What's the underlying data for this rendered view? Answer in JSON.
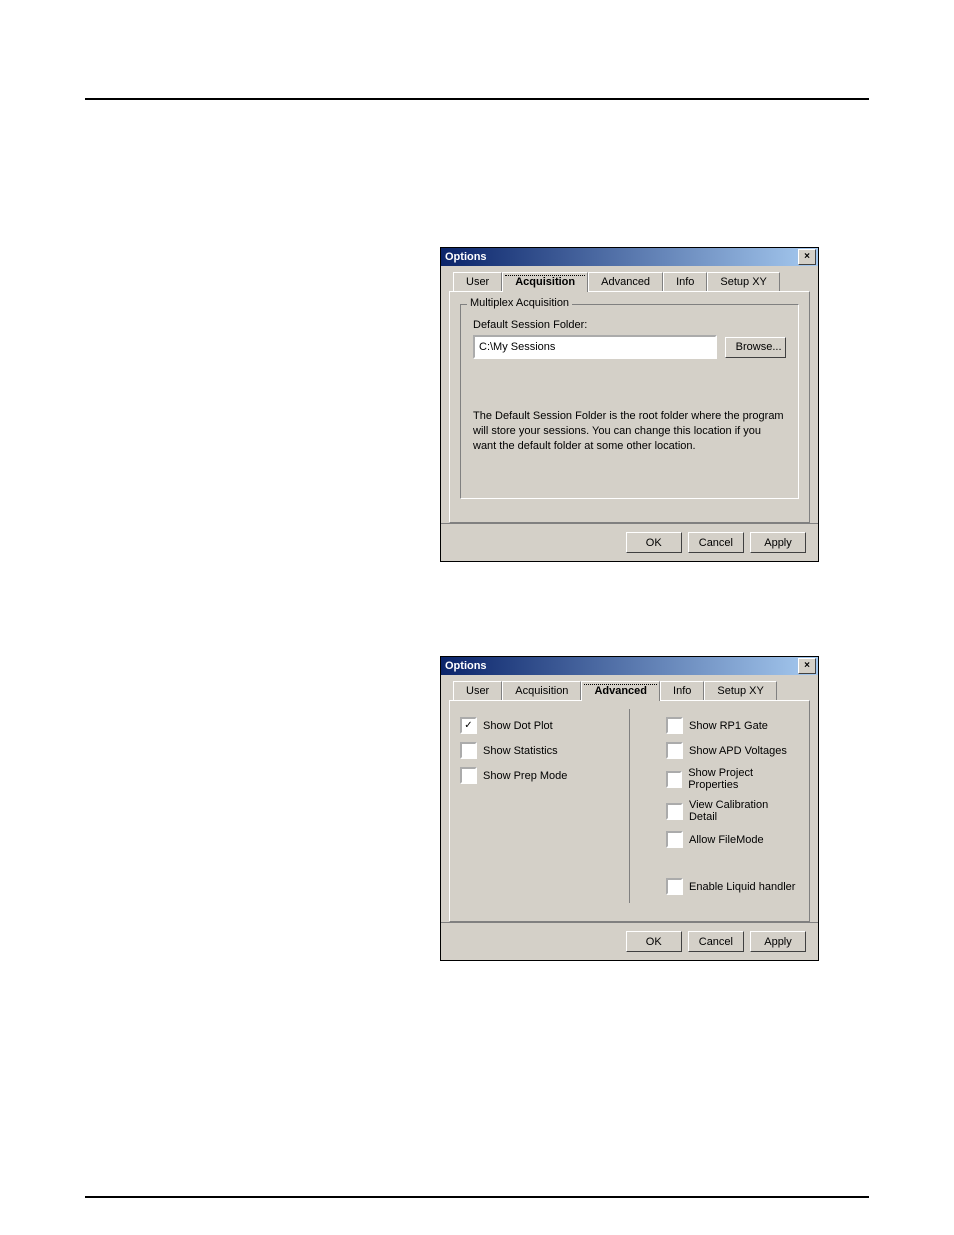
{
  "rules": {
    "top1": 98,
    "top2": 1196
  },
  "dialog1": {
    "title": "Options",
    "tabs": [
      "User",
      "Acquisition",
      "Advanced",
      "Info",
      "Setup XY"
    ],
    "activeTab": "Acquisition",
    "group": {
      "title": "Multiplex Acquisition",
      "label": "Default Session Folder:",
      "path": "C:\\My Sessions",
      "browse": "Browse..."
    },
    "help": "The Default Session Folder is the root folder where the program will store your sessions. You can change this location if you want the default folder at some other location.",
    "buttons": {
      "ok": "OK",
      "cancel": "Cancel",
      "apply": "Apply"
    }
  },
  "dialog2": {
    "title": "Options",
    "tabs": [
      "User",
      "Acquisition",
      "Advanced",
      "Info",
      "Setup XY"
    ],
    "activeTab": "Advanced",
    "left": [
      {
        "label": "Show Dot Plot",
        "checked": true
      },
      {
        "label": "Show Statistics",
        "checked": false
      },
      {
        "label": "Show Prep Mode",
        "checked": false
      }
    ],
    "right": [
      {
        "label": "Show RP1 Gate",
        "checked": false
      },
      {
        "label": "Show APD Voltages",
        "checked": false
      },
      {
        "label": "Show Project Properties",
        "checked": false
      },
      {
        "label": "View Calibration Detail",
        "checked": false
      },
      {
        "label": "Allow FileMode",
        "checked": false
      }
    ],
    "right2": [
      {
        "label": "Enable Liquid handler",
        "checked": false
      }
    ],
    "buttons": {
      "ok": "OK",
      "cancel": "Cancel",
      "apply": "Apply"
    }
  }
}
